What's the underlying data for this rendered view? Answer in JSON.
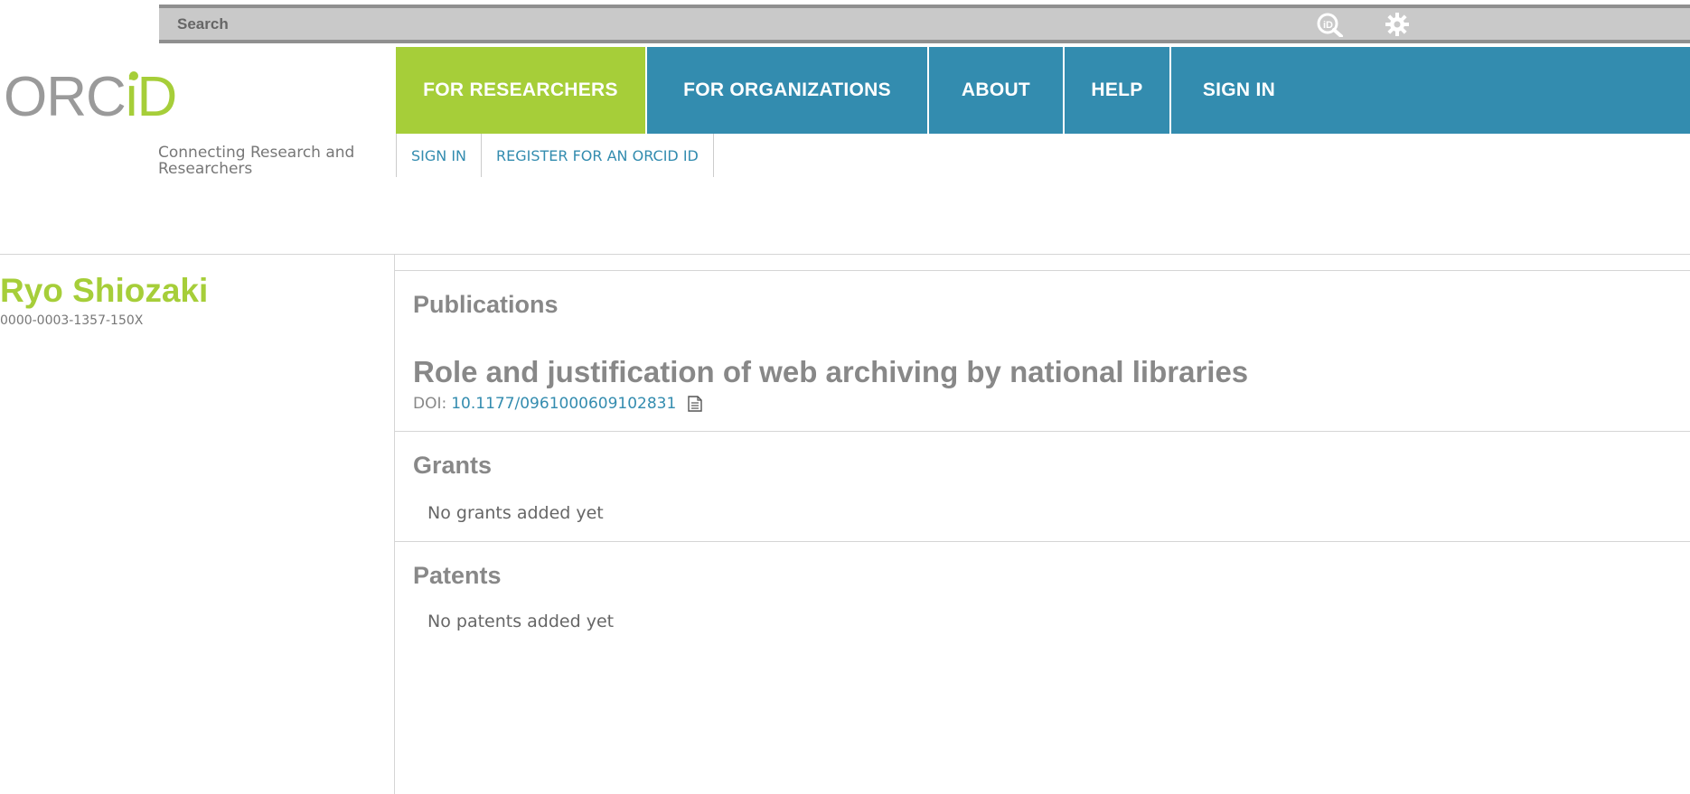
{
  "search": {
    "placeholder": "Search"
  },
  "logo": {
    "orc": "ORC",
    "id": "iD",
    "tagline": "Connecting Research and Researchers"
  },
  "nav": {
    "items": [
      {
        "label": "FOR RESEARCHERS",
        "active": true
      },
      {
        "label": "FOR ORGANIZATIONS",
        "active": false
      },
      {
        "label": "ABOUT",
        "active": false
      },
      {
        "label": "HELP",
        "active": false
      },
      {
        "label": "SIGN IN",
        "active": false
      }
    ],
    "sub_items": [
      {
        "label": "SIGN IN"
      },
      {
        "label": "REGISTER FOR AN ORCID ID"
      }
    ]
  },
  "person": {
    "name": "Ryo Shiozaki",
    "orcid": "0000-0003-1357-150X"
  },
  "sections": {
    "publications": {
      "heading": "Publications",
      "items": [
        {
          "title": "Role and justification of web archiving by national libraries",
          "doi_label": "DOI:",
          "doi": "10.1177/0961000609102831"
        }
      ]
    },
    "grants": {
      "heading": "Grants",
      "empty": "No grants added yet"
    },
    "patents": {
      "heading": "Patents",
      "empty": "No patents added yet"
    }
  },
  "colors": {
    "brand_green": "#a6ce39",
    "brand_blue": "#338caf",
    "grey_text": "#888888"
  }
}
